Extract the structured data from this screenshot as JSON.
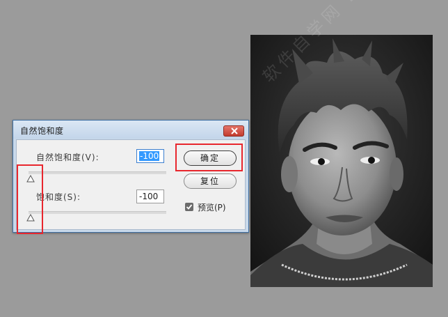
{
  "dialog": {
    "title": "自然饱和度",
    "vibrance": {
      "label": "自然饱和度(V):",
      "value": "-100"
    },
    "saturation": {
      "label": "饱和度(S):",
      "value": "-100"
    },
    "ok_label": "确定",
    "reset_label": "复位",
    "preview": {
      "label": "预览(P)",
      "checked": true
    }
  },
  "colors": {
    "annotation": "#e8262d",
    "workspace": "#9b9b9b",
    "selection": "#3399ff"
  },
  "icons": {
    "close": "close-icon",
    "check": "check-icon",
    "slider_thumb": "triangle-thumb-icon"
  },
  "watermark": "软件自学网 .COM"
}
